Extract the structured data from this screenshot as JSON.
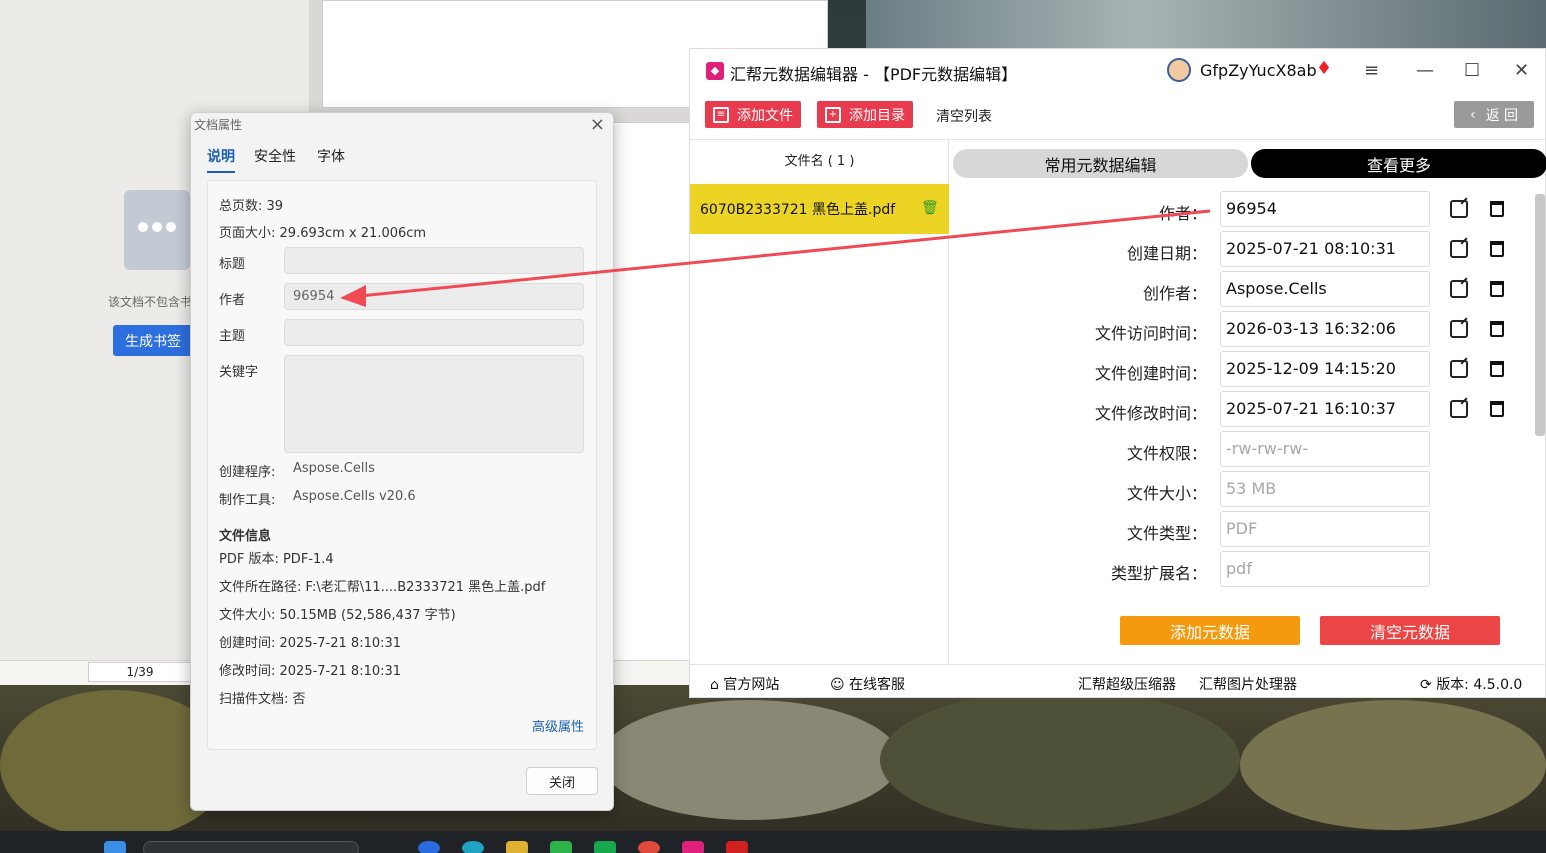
{
  "background_app": {
    "notice": "该文档不包含书",
    "generate_bookmark": "生成书签",
    "page_indicator": "1/39"
  },
  "dialog": {
    "title": "文档属性",
    "tabs": [
      "说明",
      "安全性",
      "字体"
    ],
    "total_pages_label": "总页数:",
    "total_pages": "39",
    "page_size_label": "页面大小:",
    "page_size": "29.693cm x 21.006cm",
    "title_label": "标题",
    "title_value": "",
    "author_label": "作者",
    "author_value": "96954",
    "subject_label": "主题",
    "subject_value": "",
    "keywords_label": "关键字",
    "keywords_value": "",
    "creator_label": "创建程序:",
    "creator": "Aspose.Cells",
    "producer_label": "制作工具:",
    "producer": "Aspose.Cells v20.6",
    "fileinfo_header": "文件信息",
    "pdf_version": "PDF 版本:  PDF-1.4",
    "file_path": "文件所在路径:  F:\\老汇帮\\11....B2333721 黑色上盖.pdf",
    "file_size": "文件大小:  50.15MB (52,586,437 字节)",
    "created": "创建时间:  2025-7-21 8:10:31",
    "modified": "修改时间:  2025-7-21 8:10:31",
    "scanned": "扫描件文档:  否",
    "advanced_link": "高级属性",
    "close_button": "关闭"
  },
  "app": {
    "title": "汇帮元数据编辑器 - 【PDF元数据编辑】",
    "username": "GfpZyYucX8ab",
    "toolbar": {
      "add_file": "添加文件",
      "add_folder": "添加目录",
      "clear_list": "清空列表",
      "back": "返 回"
    },
    "file_list_header": "文件名 ( 1 )",
    "files": [
      "6070B2333721 黑色上盖.pdf"
    ],
    "tabs": {
      "common": "常用元数据编辑",
      "more": "查看更多"
    },
    "fields": [
      {
        "label": "作者：",
        "value": "96954",
        "editable": true
      },
      {
        "label": "创建日期：",
        "value": "2025-07-21 08:10:31",
        "editable": true
      },
      {
        "label": "创作者：",
        "value": "Aspose.Cells",
        "editable": true
      },
      {
        "label": "文件访问时间：",
        "value": "2026-03-13 16:32:06",
        "editable": true
      },
      {
        "label": "文件创建时间：",
        "value": "2025-12-09 14:15:20",
        "editable": true
      },
      {
        "label": "文件修改时间：",
        "value": "2025-07-21 16:10:37",
        "editable": true
      },
      {
        "label": "文件权限：",
        "value": "-rw-rw-rw-",
        "editable": false
      },
      {
        "label": "文件大小：",
        "value": "53 MB",
        "editable": false
      },
      {
        "label": "文件类型：",
        "value": "PDF",
        "editable": false
      },
      {
        "label": "类型扩展名：",
        "value": "pdf",
        "editable": false
      }
    ],
    "add_metadata": "添加元数据",
    "clear_metadata": "清空元数据",
    "footer": {
      "website": "官方网站",
      "support": "在线客服",
      "compressor": "汇帮超级压缩器",
      "image_tool": "汇帮图片处理器",
      "version": "版本:  4.5.0.0"
    },
    "colors": {
      "accent_red": "#e83b4d",
      "highlight_yellow": "#ecd424",
      "orange": "#f59a0e"
    }
  }
}
